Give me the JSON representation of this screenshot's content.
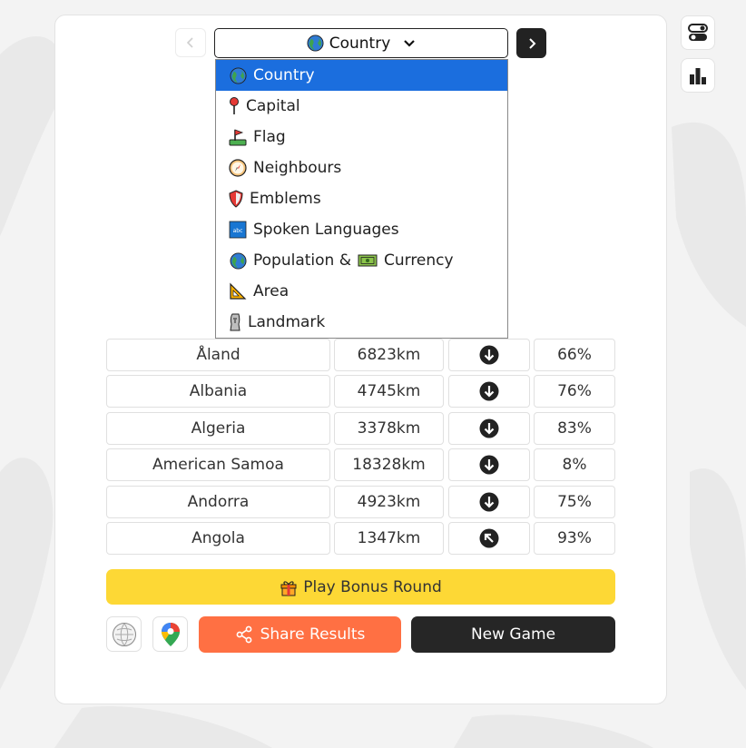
{
  "header": {
    "selected_mode": "Country",
    "prev_icon": "chevron-left-icon",
    "next_icon": "chevron-right-icon"
  },
  "side_buttons": [
    {
      "icon": "settings-toggle-icon"
    },
    {
      "icon": "stats-bar-chart-icon"
    }
  ],
  "dropdown": {
    "items": [
      {
        "label": "Country",
        "icon": "globe-icon",
        "selected": true
      },
      {
        "label": "Capital",
        "icon": "pin-icon"
      },
      {
        "label": "Flag",
        "icon": "flag-icon"
      },
      {
        "label": "Neighbours",
        "icon": "compass-icon"
      },
      {
        "label": "Emblems",
        "icon": "shield-icon"
      },
      {
        "label": "Spoken Languages",
        "icon": "abc-icon"
      },
      {
        "label": "Population &",
        "label2": "Currency",
        "icon": "globe-icon",
        "icon2": "money-icon"
      },
      {
        "label": "Area",
        "icon": "triangle-ruler-icon"
      },
      {
        "label": "Landmark",
        "icon": "moai-icon"
      }
    ]
  },
  "guesses": [
    {
      "country": "Åland",
      "distance": "6823km",
      "direction": "down",
      "proximity": "66%"
    },
    {
      "country": "Albania",
      "distance": "4745km",
      "direction": "down",
      "proximity": "76%"
    },
    {
      "country": "Algeria",
      "distance": "3378km",
      "direction": "down",
      "proximity": "83%"
    },
    {
      "country": "American Samoa",
      "distance": "18328km",
      "direction": "down",
      "proximity": "8%"
    },
    {
      "country": "Andorra",
      "distance": "4923km",
      "direction": "down",
      "proximity": "75%"
    },
    {
      "country": "Angola",
      "distance": "1347km",
      "direction": "up-left",
      "proximity": "93%"
    }
  ],
  "actions": {
    "bonus_label": "Play Bonus Round",
    "share_label": "Share Results",
    "new_game_label": "New Game",
    "wikipedia_icon": "wikipedia-icon",
    "maps_icon": "google-maps-icon"
  },
  "colors": {
    "selected_bg": "#1b6ede",
    "bonus_bg": "#fdd835",
    "share_bg": "#ff7043",
    "dark": "#262626"
  }
}
